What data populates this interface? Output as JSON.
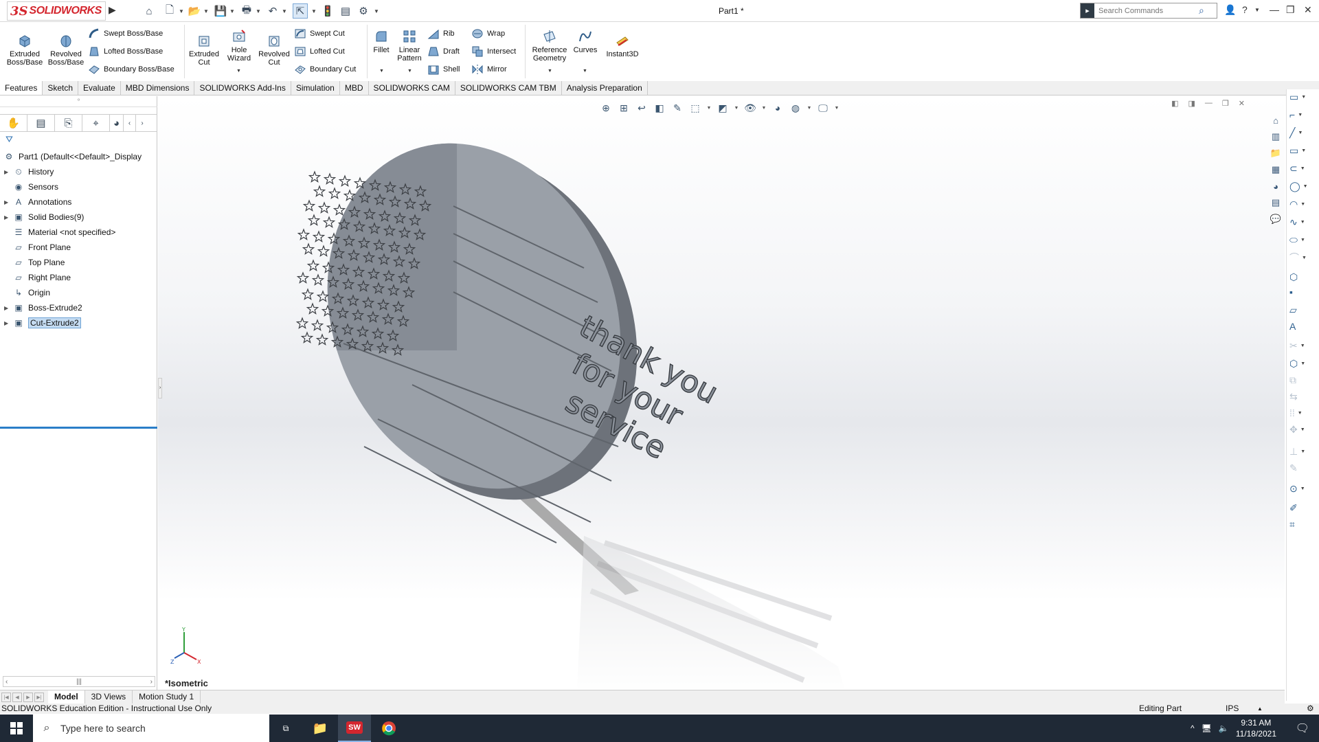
{
  "app": {
    "logo_ds": "3S",
    "logo_name": "SOLIDWORKS",
    "document_title": "Part1 *",
    "search_placeholder": "Search Commands"
  },
  "ribbon": {
    "extruded_boss": "Extruded Boss/Base",
    "revolved_boss": "Revolved Boss/Base",
    "swept_boss": "Swept Boss/Base",
    "lofted_boss": "Lofted Boss/Base",
    "boundary_boss": "Boundary Boss/Base",
    "extruded_cut": "Extruded Cut",
    "hole_wizard": "Hole Wizard",
    "revolved_cut": "Revolved Cut",
    "swept_cut": "Swept Cut",
    "lofted_cut": "Lofted Cut",
    "boundary_cut": "Boundary Cut",
    "fillet": "Fillet",
    "linear_pattern": "Linear Pattern",
    "rib": "Rib",
    "draft": "Draft",
    "shell": "Shell",
    "wrap": "Wrap",
    "intersect": "Intersect",
    "mirror": "Mirror",
    "reference_geometry": "Reference Geometry",
    "curves": "Curves",
    "instant3d": "Instant3D"
  },
  "tabs": [
    "Features",
    "Sketch",
    "Evaluate",
    "MBD Dimensions",
    "SOLIDWORKS Add-Ins",
    "Simulation",
    "MBD",
    "SOLIDWORKS CAM",
    "SOLIDWORKS CAM TBM",
    "Analysis Preparation"
  ],
  "tree": {
    "root": "Part1  (Default<<Default>_Display",
    "items": [
      "History",
      "Sensors",
      "Annotations",
      "Solid Bodies(9)",
      "Material <not specified>",
      "Front Plane",
      "Top Plane",
      "Right Plane",
      "Origin",
      "Boss-Extrude2",
      "Cut-Extrude2"
    ]
  },
  "viewport": {
    "view_name": "*Isometric",
    "engraved_text": [
      "thank you",
      "for your",
      "service"
    ]
  },
  "bottom_tabs": [
    "Model",
    "3D Views",
    "Motion Study 1"
  ],
  "status": {
    "edition": "SOLIDWORKS Education Edition - Instructional Use Only",
    "mode": "Editing Part",
    "units": "IPS"
  },
  "taskbar": {
    "search_placeholder": "Type here to search",
    "time": "9:31 AM",
    "date": "11/18/2021"
  },
  "icons": {
    "accent_red": "#d4262e",
    "model_fill": "#9aa0a8",
    "taskbar_bg": "#1f2936"
  }
}
